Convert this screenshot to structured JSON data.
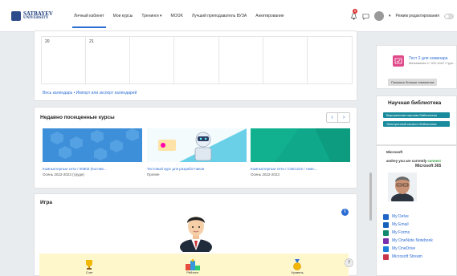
{
  "navbar": {
    "logo_line1": "SATBAYEV",
    "logo_line2": "UNIVERSITY",
    "links": [
      "Личный кабинет",
      "Мои курсы",
      "Тренинги ▾",
      "MOOK",
      "Лучший преподаватель ВУЗА",
      "Анкетирование"
    ],
    "notification_count": "8",
    "edit_mode_label": "Режим редактирования"
  },
  "calendar": {
    "day_a": "20",
    "day_b": "21",
    "links_text": "Весь календарь • Импорт или экспорт календарей"
  },
  "recent": {
    "title": "Недавно посещенные курсы",
    "prev": "‹",
    "next": "›",
    "courses": [
      {
        "name": "Компьютерные сети / 0080Z (Косчив...",
        "category": "Осень 2022-2023 (трудн)",
        "color": "#3c8fd8"
      },
      {
        "name": "Тестовый курс для разработчиков",
        "category": "Прочее",
        "color": "#6ad0e8"
      },
      {
        "name": "Компьютерные сети / CSE1222 / Амес...",
        "category": "Осень 2022-2023",
        "color": "#0fa88a"
      }
    ]
  },
  "game": {
    "title": "Игра",
    "info": "i",
    "help": "?",
    "stats": [
      "Счет",
      "Рейтинг",
      "Уровень"
    ]
  },
  "sidebar": {
    "test_title": "Тест 2 для семинара",
    "test_sub": "Математика II / ICE-1042 / Груп...",
    "more_events": "Показать больше элементов",
    "library_title": "Научная библиотека",
    "lib_btn1": "Виртуальная научная библиотека",
    "lib_btn2": "Электронный каталог библиотеки",
    "ms_title": "Microsoft",
    "ms_greeting_a": "andrey you are currently",
    "ms_greeting_b": "connect",
    "ms_365": "Microsoft 365",
    "ms_items": [
      {
        "label": "My Delve",
        "color": "#1c64c8"
      },
      {
        "label": "My Email",
        "color": "#1560b8"
      },
      {
        "label": "My Forms",
        "color": "#138a6e"
      },
      {
        "label": "My OneNote Notebook",
        "color": "#7a2fb0"
      },
      {
        "label": "My OneDrive",
        "color": "#1e7fd8"
      },
      {
        "label": "Microsoft Stream",
        "color": "#c8364a"
      }
    ]
  }
}
